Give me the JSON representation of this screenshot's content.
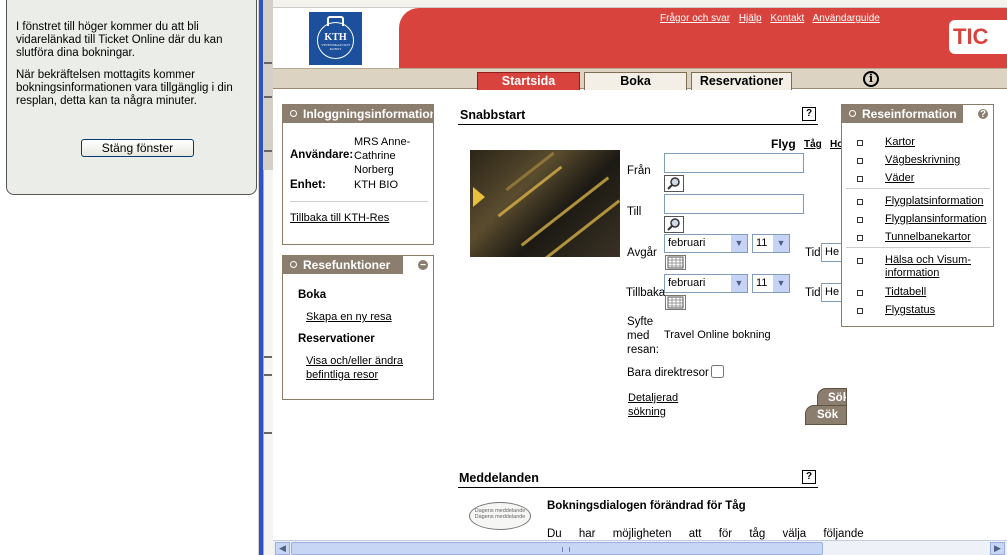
{
  "popup": {
    "line1": "I fönstret till höger kommer du att bli vidarelänkad till Ticket Online där du kan slutföra dina bokningar.",
    "line2": "När bekräftelsen mottagits kommer bokningsinformationen vara tillgänglig i din resplan, detta kan ta några minuter.",
    "close_label": "Stäng fönster"
  },
  "header": {
    "logo_text": "KTH",
    "logo_subtext": "VETENSKAP OCH KONST",
    "links": [
      "Frågor och svar",
      "Hjälp",
      "Kontakt",
      "Användarguide"
    ],
    "brand": "TIC",
    "brand_color": "#d9433d"
  },
  "tabs": [
    {
      "label": "Startsida",
      "active": true
    },
    {
      "label": "Boka",
      "active": false
    },
    {
      "label": "Reservationer",
      "active": false
    }
  ],
  "info_icon": "i",
  "login": {
    "title": "Inloggningsinformation",
    "user_label": "Användare:",
    "user_value": "MRS Anne-Cathrine Norberg",
    "unit_label": "Enhet:",
    "unit_value": "KTH BIO",
    "back_link": "Tillbaka till KTH-Res"
  },
  "functions": {
    "title": "Resefunktioner",
    "collapse": "−",
    "book_heading": "Boka",
    "new_trip": "Skapa en ny resa",
    "res_heading": "Reservationer",
    "res_link": "Visa och/eller ändra befintliga resor"
  },
  "quickstart": {
    "title": "Snabbstart",
    "help": "?",
    "modes": [
      "Flyg",
      "Tåg",
      "Ho"
    ],
    "from_label": "Från",
    "to_label": "Till",
    "depart_label": "Avgår",
    "return_label": "Tillbaka",
    "depart_month": "februari",
    "depart_day": "11",
    "return_month": "februari",
    "return_day": "11",
    "time_label": "Tid",
    "time_value": "He",
    "purpose_label": "Syfte med resan:",
    "purpose_value": "Travel Online bokning",
    "direct_label": "Bara direktresor",
    "detailed_link": "Detaljerad sökning",
    "search1": "Sök",
    "search2": "Sök"
  },
  "messages": {
    "title": "Meddelanden",
    "help": "?",
    "bubble": "Dagens meddelande Dagens meddelande",
    "headline": "Bokningsdialogen förändrad för Tåg",
    "body": "Du har möjligheten att för tåg välja följande"
  },
  "travel_info": {
    "title": "Reseinformation",
    "help": "?",
    "group1": [
      "Kartor",
      "Vägbeskrivning",
      "Väder"
    ],
    "group2": [
      "Flygplatsinformation",
      "Flygplansinformation",
      "Tunnelbanekartor"
    ],
    "group3": [
      "Hälsa och Visum-information",
      "Tidtabell",
      "Flygstatus"
    ]
  }
}
